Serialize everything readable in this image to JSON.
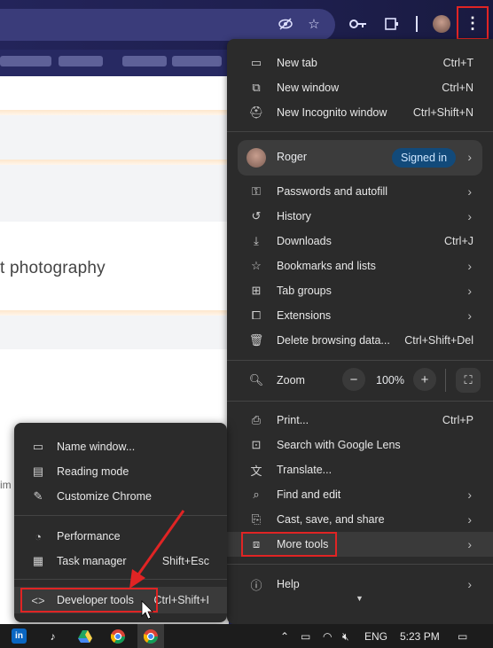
{
  "browser": {
    "menu_button_icon": "more-vertical-icon"
  },
  "page": {
    "visible_text": "t photography",
    "partial_text": "im"
  },
  "chrome_menu": {
    "new_tab": {
      "label": "New tab",
      "shortcut": "Ctrl+T"
    },
    "new_window": {
      "label": "New window",
      "shortcut": "Ctrl+N"
    },
    "new_incognito": {
      "label": "New Incognito window",
      "shortcut": "Ctrl+Shift+N"
    },
    "profile": {
      "name": "Roger",
      "badge": "Signed in"
    },
    "passwords": {
      "label": "Passwords and autofill"
    },
    "history": {
      "label": "History"
    },
    "downloads": {
      "label": "Downloads",
      "shortcut": "Ctrl+J"
    },
    "bookmarks": {
      "label": "Bookmarks and lists"
    },
    "tab_groups": {
      "label": "Tab groups"
    },
    "extensions": {
      "label": "Extensions"
    },
    "delete_data": {
      "label": "Delete browsing data...",
      "shortcut": "Ctrl+Shift+Del"
    },
    "zoom": {
      "label": "Zoom",
      "value": "100%",
      "minus": "−",
      "plus": "+"
    },
    "print": {
      "label": "Print...",
      "shortcut": "Ctrl+P"
    },
    "google_lens": {
      "label": "Search with Google Lens"
    },
    "translate": {
      "label": "Translate..."
    },
    "find_edit": {
      "label": "Find and edit"
    },
    "cast_save": {
      "label": "Cast, save, and share"
    },
    "more_tools": {
      "label": "More tools"
    },
    "help": {
      "label": "Help"
    }
  },
  "more_tools_menu": {
    "name_window": {
      "label": "Name window..."
    },
    "reading_mode": {
      "label": "Reading mode"
    },
    "customize": {
      "label": "Customize Chrome"
    },
    "performance": {
      "label": "Performance"
    },
    "task_manager": {
      "label": "Task manager",
      "shortcut": "Shift+Esc"
    },
    "developer_tools": {
      "label": "Developer tools",
      "shortcut": "Ctrl+Shift+I"
    }
  },
  "taskbar": {
    "language": "ENG",
    "time": "5:23 PM"
  },
  "colors": {
    "highlight_box": "#e02424",
    "menu_bg": "#2b2b2b",
    "signed_in_badge": "#124a7a"
  }
}
